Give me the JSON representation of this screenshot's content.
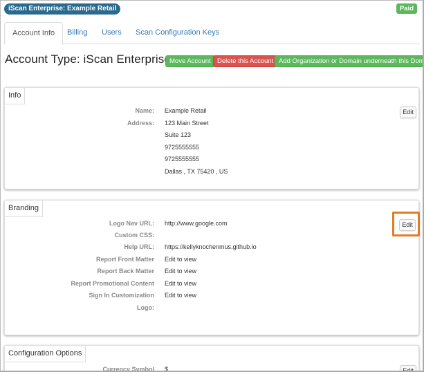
{
  "header": {
    "org_badge": "iScan Enterprise: Example Retail",
    "status_badge": "Paid"
  },
  "tabs": [
    {
      "label": "Account Info",
      "active": true
    },
    {
      "label": "Billing",
      "active": false
    },
    {
      "label": "Users",
      "active": false
    },
    {
      "label": "Scan Configuration Keys",
      "active": false
    }
  ],
  "page_title": "Account Type: iScan Enterprise",
  "actions": {
    "move": "Move Account",
    "delete": "Delete this Account",
    "add": "Add Organization or Domain underneath this Domain"
  },
  "info_panel": {
    "heading": "Info",
    "edit_label": "Edit",
    "name_label": "Name:",
    "name": "Example Retail",
    "address_label": "Address:",
    "address_lines": [
      "123 Main Street",
      "Suite 123",
      "9725555555",
      "9725555555",
      "Dallas , TX 75420 , US"
    ]
  },
  "branding_panel": {
    "heading": "Branding",
    "edit_label": "Edit",
    "rows": [
      {
        "label": "Logo Nav URL:",
        "value": "http://www.google.com"
      },
      {
        "label": "Custom CSS:",
        "value": ""
      },
      {
        "label": "Help URL:",
        "value": "https://kellyknochenmus.github.io"
      },
      {
        "label": "Report Front Matter",
        "value": "Edit to view"
      },
      {
        "label": "Report Back Matter",
        "value": "Edit to view"
      },
      {
        "label": "Report Promotional Content",
        "value": "Edit to view"
      },
      {
        "label": "Sign In Customization",
        "value": "Edit to view"
      },
      {
        "label": "Logo:",
        "value": ""
      }
    ]
  },
  "config_panel": {
    "heading": "Configuration Options",
    "edit_label": "Edit",
    "rows": [
      {
        "label": "Currency Symbol",
        "value": "$"
      }
    ]
  },
  "colors": {
    "org_badge": "#2a6a8f",
    "success": "#5cb85c",
    "danger": "#d9534f",
    "link": "#337ab7",
    "highlight": "#e07b27"
  }
}
